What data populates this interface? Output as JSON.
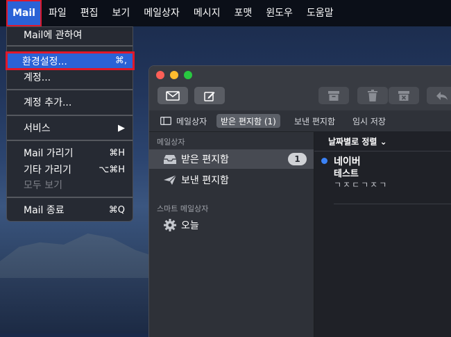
{
  "menubar": {
    "app": "Mail",
    "items": [
      "파일",
      "편집",
      "보기",
      "메일상자",
      "메시지",
      "포맷",
      "윈도우",
      "도움말"
    ]
  },
  "app_menu": {
    "about": "Mail에 관하여",
    "preferences": "환경설정...",
    "preferences_shortcut": "⌘,",
    "accounts": "계정...",
    "add_account": "계정 추가...",
    "services": "서비스",
    "services_arrow": "▶",
    "hide_mail": "Mail 가리기",
    "hide_mail_shortcut": "⌘H",
    "hide_others": "기타 가리기",
    "hide_others_shortcut": "⌥⌘H",
    "show_all": "모두 보기",
    "quit": "Mail 종료",
    "quit_shortcut": "⌘Q"
  },
  "favorites": {
    "mailboxes": "메일상자",
    "inbox": "받은 편지함 (1)",
    "sent": "보낸 편지함",
    "drafts": "임시 저장"
  },
  "sidebar": {
    "section_mailboxes": "메일상자",
    "inbox": "받은 편지함",
    "inbox_badge": "1",
    "sent": "보낸 편지함",
    "section_smart": "스마트 메일상자",
    "today": "오늘"
  },
  "message_list": {
    "sort_label": "날짜별로 정렬 ⌄",
    "messages": [
      {
        "sender": "네이버",
        "subject": "테스트",
        "preview": "ㄱㅈㄷㄱㅈㄱ",
        "unread": true
      }
    ]
  },
  "colors": {
    "highlight_blue": "#2a62d6",
    "annotation_red": "#e0182a",
    "unread_blue": "#3b82f6"
  },
  "icons": [
    "new-message-icon",
    "compose-icon",
    "archive-icon",
    "trash-icon",
    "junk-icon",
    "reply-icon",
    "sidebar-toggle-icon",
    "inbox-tray-icon",
    "sent-plane-icon",
    "gear-icon"
  ]
}
